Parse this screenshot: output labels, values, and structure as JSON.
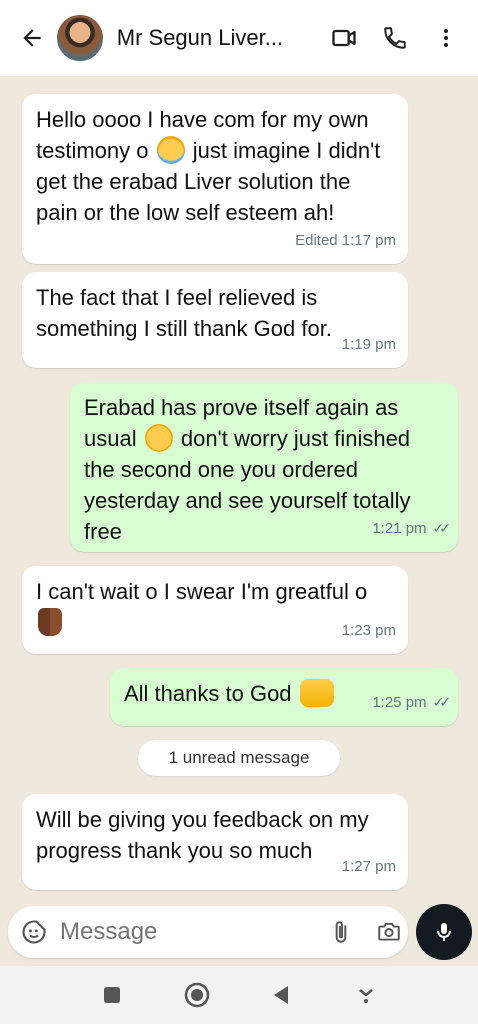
{
  "header": {
    "contact_name": "Mr Segun Liver...",
    "icons": [
      "back-arrow-icon",
      "video-call-icon",
      "phone-icon",
      "more-vert-icon"
    ]
  },
  "messages": [
    {
      "direction": "in",
      "text_a": "Hello oooo I have com for my own testimony o",
      "text_b": "just imagine I didn't get the erabad Liver solution the pain or the low self esteem ah!",
      "emoji": "crying-face",
      "meta": "Edited 1:17 pm"
    },
    {
      "direction": "in",
      "text": "The fact that I feel relieved is something I still thank God for.",
      "meta": "1:19 pm"
    },
    {
      "direction": "out",
      "text_a": "Erabad has prove itself again as usual",
      "text_b": "don't worry just finished the second one you ordered yesterday and see yourself totally free",
      "emoji": "tears-of-joy",
      "meta": "1:21 pm",
      "read": true
    },
    {
      "direction": "in",
      "text": "I can't wait o I swear I'm greatful o",
      "emoji": "folded-hands",
      "meta": "1:23 pm"
    },
    {
      "direction": "out",
      "text": "All thanks to God",
      "emoji": "raising-hands",
      "meta": "1:25 pm",
      "read": true
    },
    {
      "direction": "in",
      "text": "Will be giving you feedback on my progress thank you so much",
      "meta": "1:27 pm"
    }
  ],
  "unread_banner": "1 unread message",
  "composer": {
    "placeholder": "Message"
  },
  "colors": {
    "incoming": "#ffffff",
    "outgoing": "#d9fdd3",
    "background": "#efe8dd",
    "mic_button": "#111b21"
  }
}
